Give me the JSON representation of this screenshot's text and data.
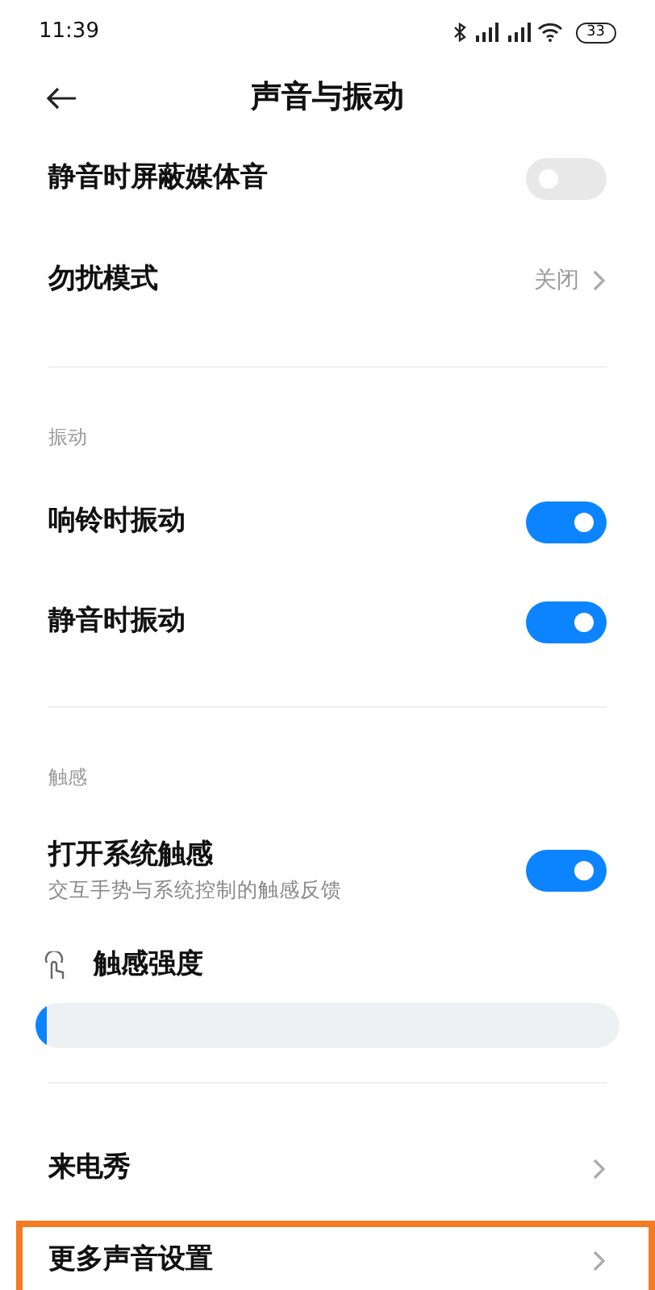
{
  "status_bar": {
    "time": "11:39",
    "battery": "33"
  },
  "header": {
    "title": "声音与振动"
  },
  "items": [
    {
      "kind": "toggle",
      "label": "静音时屏蔽媒体音",
      "on": false
    },
    {
      "kind": "link",
      "label": "勿扰模式",
      "value": "关闭"
    },
    {
      "kind": "divider"
    },
    {
      "kind": "section",
      "label": "振动"
    },
    {
      "kind": "toggle",
      "label": "响铃时振动",
      "on": true
    },
    {
      "kind": "toggle",
      "label": "静音时振动",
      "on": true
    },
    {
      "kind": "divider"
    },
    {
      "kind": "section",
      "label": "触感"
    },
    {
      "kind": "toggle",
      "label": "打开系统触感",
      "subtitle": "交互手势与系统控制的触感反馈",
      "on": true
    },
    {
      "kind": "slider",
      "label": "触感强度",
      "level": 0.02
    },
    {
      "kind": "divider"
    },
    {
      "kind": "link",
      "label": "来电秀"
    },
    {
      "kind": "link",
      "label": "更多声音设置",
      "highlighted": true
    }
  ]
}
